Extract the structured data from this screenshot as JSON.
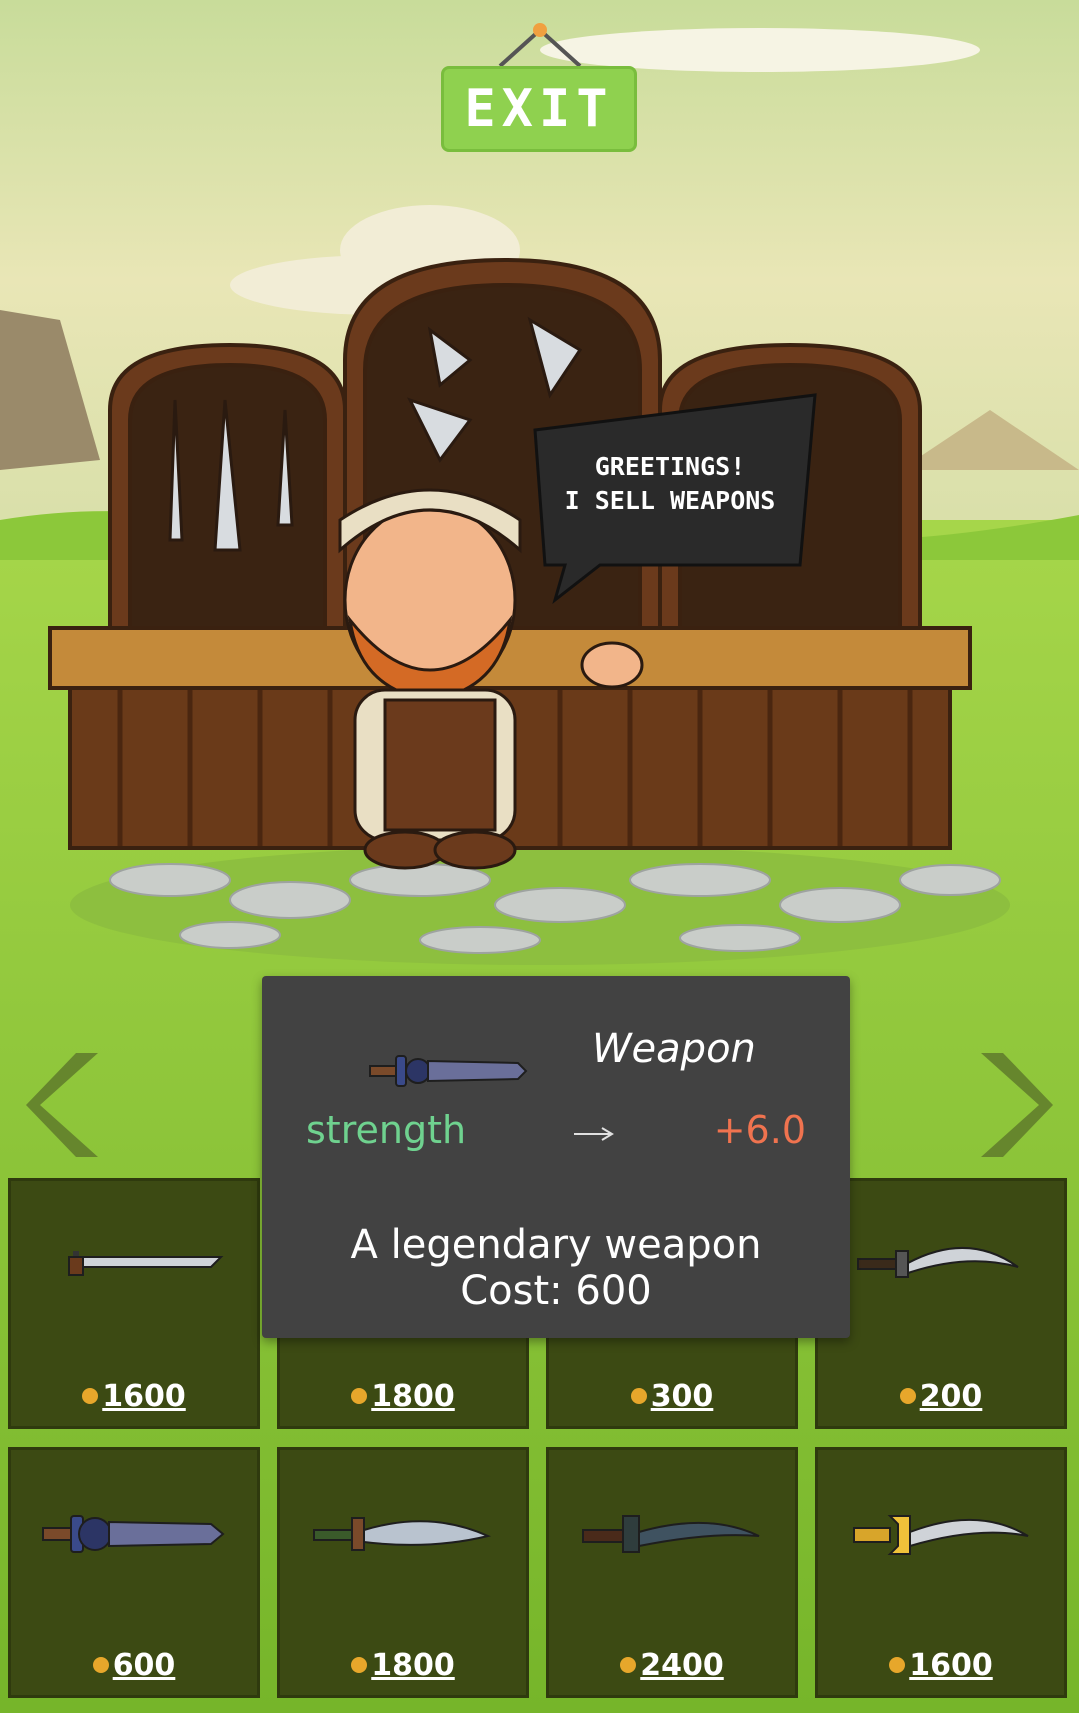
{
  "exit_label": "EXIT",
  "speech": {
    "line1": "GREETINGS!",
    "line2": "I SELL WEAPONS"
  },
  "tooltip": {
    "title": "Weapon",
    "stat_name": "strength",
    "stat_arrow": "arrow-right-icon",
    "stat_value": "+6.0",
    "description": "A legendary weapon",
    "cost_label": "Cost:",
    "cost_value": "600"
  },
  "nav": {
    "prev_icon": "chevron-left-icon",
    "next_icon": "chevron-right-icon"
  },
  "shop": {
    "items": [
      {
        "price": "1600",
        "icon": "katana-icon"
      },
      {
        "price": "1800",
        "icon": "sword-icon"
      },
      {
        "price": "300",
        "icon": "sword-icon"
      },
      {
        "price": "200",
        "icon": "curved-dagger-icon"
      },
      {
        "price": "600",
        "icon": "legendary-sword-icon"
      },
      {
        "price": "1800",
        "icon": "serrated-blade-icon"
      },
      {
        "price": "2400",
        "icon": "dark-scimitar-icon"
      },
      {
        "price": "1600",
        "icon": "golden-scimitar-icon"
      }
    ]
  },
  "colors": {
    "exit_green": "#8fd14f",
    "stat_green": "#6fd28f",
    "bonus_orange": "#f0734f",
    "coin": "#e7a72b"
  }
}
